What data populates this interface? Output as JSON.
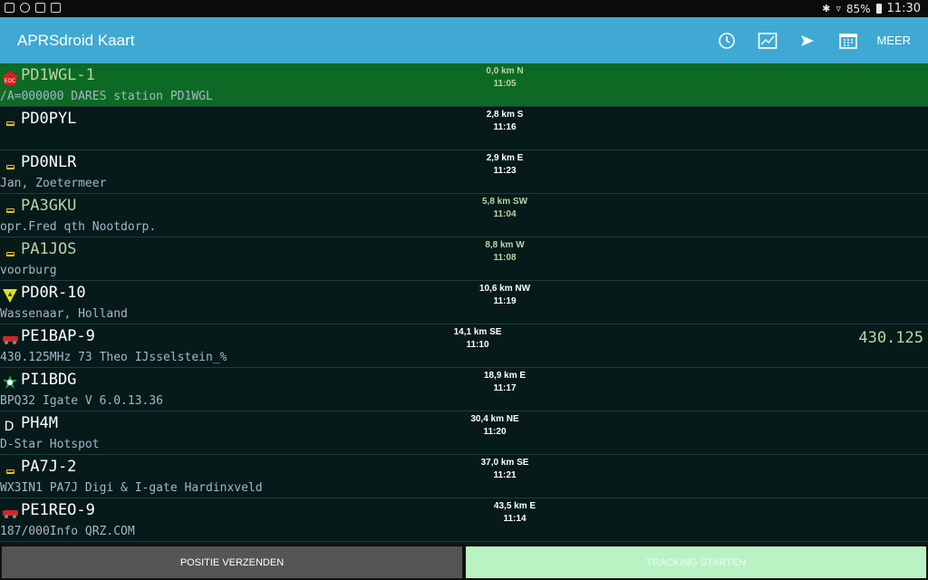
{
  "statusbar": {
    "battery": "85%",
    "time": "11:30"
  },
  "app": {
    "title": "APRSdroid Kaart",
    "more_label": "MEER"
  },
  "icons": {
    "history": "clock-icon",
    "map": "map-icon",
    "send": "send-icon",
    "calendar": "calendar-icon"
  },
  "stations": [
    {
      "call": "PD1WGL-1",
      "comment": "/A=000000 DARES station PD1WGL",
      "dist": "0,0 km N",
      "time": "11:05",
      "icon": "eoc-icon",
      "selected": true
    },
    {
      "call": "PD0PYL",
      "comment": "",
      "dist": "2,8 km S",
      "time": "11:16",
      "icon": "car-icon"
    },
    {
      "call": "PD0NLR",
      "comment": "Jan, Zoetermeer",
      "dist": "2,9 km E",
      "time": "11:23",
      "icon": "car-icon"
    },
    {
      "call": "PA3GKU",
      "comment": "opr.Fred qth Nootdorp.",
      "dist": "5,8 km SW",
      "time": "11:04",
      "icon": "car-icon"
    },
    {
      "call": "PA1JOS",
      "comment": "voorburg",
      "dist": "8,8 km W",
      "time": "11:08",
      "icon": "car-icon"
    },
    {
      "call": "PD0R-10",
      "comment": "Wassenaar, Holland",
      "dist": "10,6 km NW",
      "time": "11:19",
      "icon": "igate-icon"
    },
    {
      "call": "PE1BAP-9",
      "comment": "430.125MHz 73 Theo IJsselstein_%",
      "dist": "14,1 km SE",
      "time": "11:10",
      "icon": "truck-icon",
      "freq": "430.125"
    },
    {
      "call": "PI1BDG",
      "comment": " BPQ32 Igate V 6.0.13.36",
      "dist": "18,9 km E",
      "time": "11:17",
      "icon": "digi-icon"
    },
    {
      "call": "PH4M",
      "comment": "D-Star Hotspot",
      "dist": "30,4 km NE",
      "time": "11:20",
      "icon": "dstar-icon"
    },
    {
      "call": "PA7J-2",
      "comment": "WX3IN1 PA7J Digi & I-gate Hardinxveld",
      "dist": "37,0 km SE",
      "time": "11:21",
      "icon": "car-icon"
    },
    {
      "call": "PE1REO-9",
      "comment": "187/000Info QRZ.COM",
      "dist": "43,5 km E",
      "time": "11:14",
      "icon": "truck-icon"
    }
  ],
  "buttons": {
    "send_position": "POSITIE VERZENDEN",
    "start_tracking": "TRACKING STARTEN"
  }
}
